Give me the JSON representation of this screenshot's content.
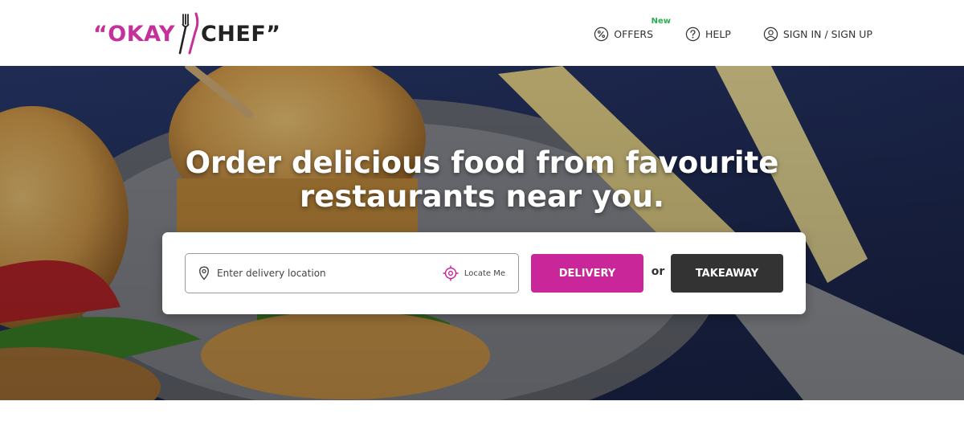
{
  "brand": {
    "logo_part1": "“OKAY",
    "logo_part2": "CHEF”",
    "accent_color": "#c9269a",
    "dark_color": "#333333"
  },
  "nav": {
    "offers": {
      "label": "OFFERS",
      "icon": "percent-icon",
      "badge": "New",
      "badge_color": "#2eac4f"
    },
    "help": {
      "label": "HELP",
      "icon": "question-icon"
    },
    "auth": {
      "label": "SIGN IN / SIGN UP",
      "icon": "user-icon"
    }
  },
  "hero": {
    "title_line1": "Order delicious food from favourite",
    "title_line2": "restaurants near you."
  },
  "search": {
    "placeholder": "Enter delivery location",
    "value": "",
    "locate_label": "Locate Me",
    "delivery_label": "DELIVERY",
    "or_label": "or",
    "takeaway_label": "TAKEAWAY"
  }
}
